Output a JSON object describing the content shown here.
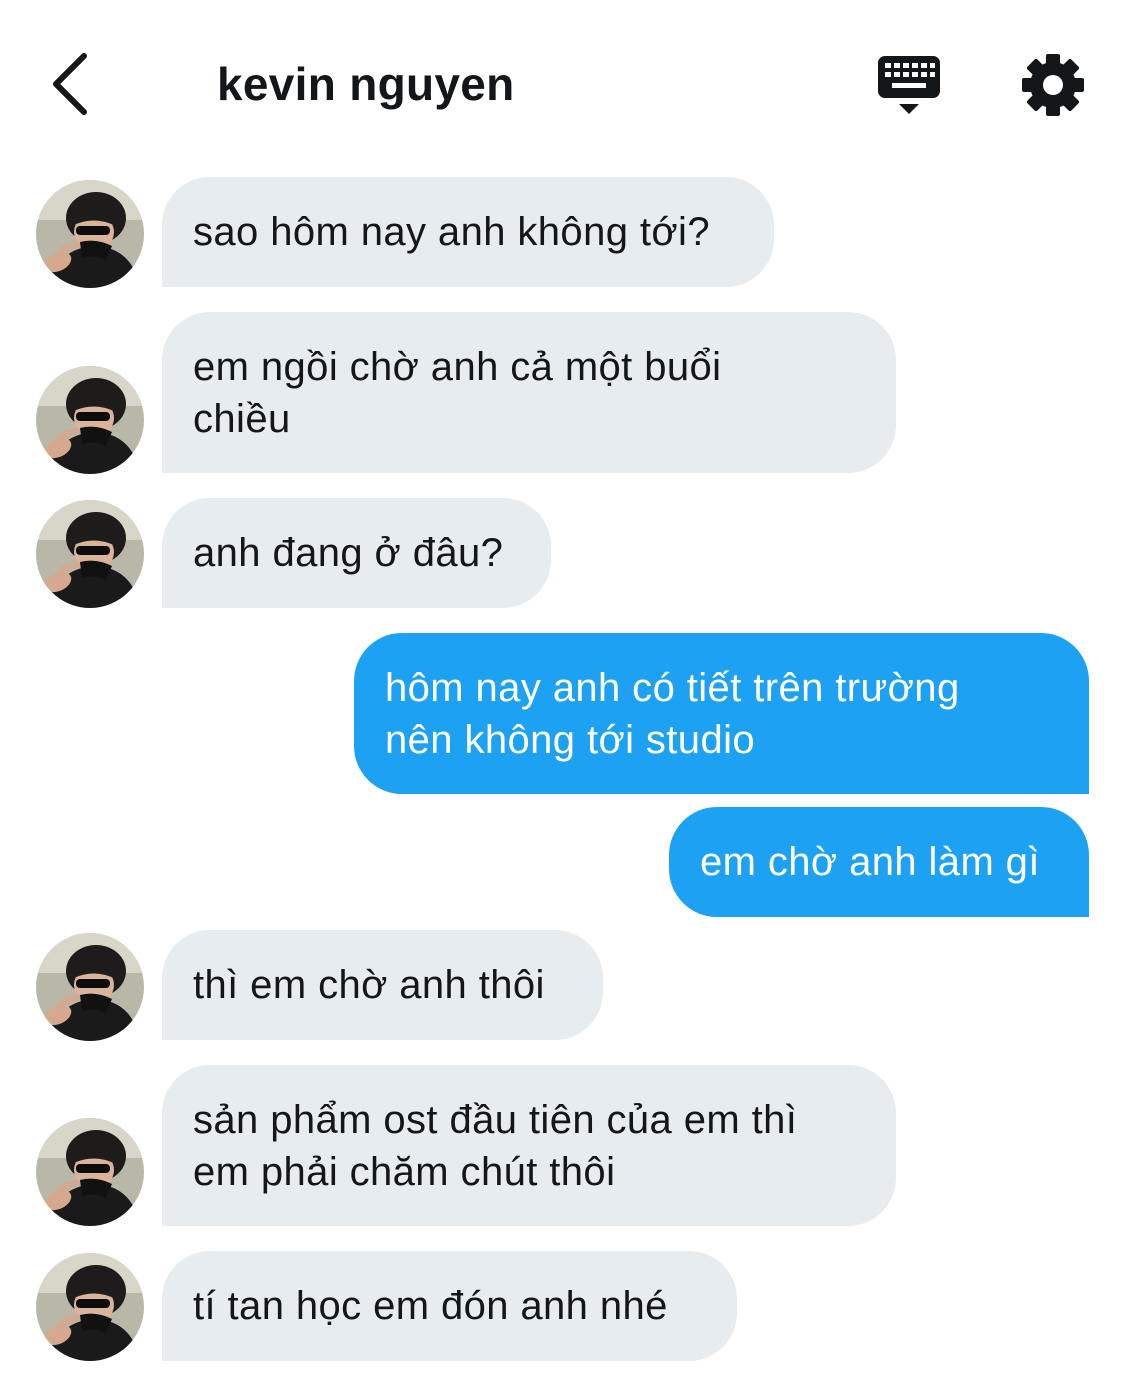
{
  "header": {
    "title": "kevin nguyen",
    "back_icon": "chevron-left-icon",
    "keyboard_icon": "keyboard-icon",
    "settings_icon": "gear-icon"
  },
  "colors": {
    "incoming_bubble": "#e6ecf0",
    "outgoing_bubble": "#1da1f2",
    "text": "#14171a"
  },
  "messages": [
    {
      "sender": "kevin nguyen",
      "direction": "incoming",
      "text": "sao hôm nay anh không tới?"
    },
    {
      "sender": "kevin nguyen",
      "direction": "incoming",
      "text": "em ngồi chờ anh cả một buổi\nchiều"
    },
    {
      "sender": "kevin nguyen",
      "direction": "incoming",
      "text": "anh đang ở đâu?"
    },
    {
      "sender": "me",
      "direction": "outgoing",
      "text": "hôm nay anh có tiết trên trường\nnên không tới studio"
    },
    {
      "sender": "me",
      "direction": "outgoing",
      "text": "em chờ anh làm gì"
    },
    {
      "sender": "kevin nguyen",
      "direction": "incoming",
      "text": "thì em chờ anh thôi"
    },
    {
      "sender": "kevin nguyen",
      "direction": "incoming",
      "text": "sản phẩm ost đầu tiên của em thì\nem phải chăm chút thôi"
    },
    {
      "sender": "kevin nguyen",
      "direction": "incoming",
      "text": "tí tan học em đón anh nhé"
    }
  ]
}
